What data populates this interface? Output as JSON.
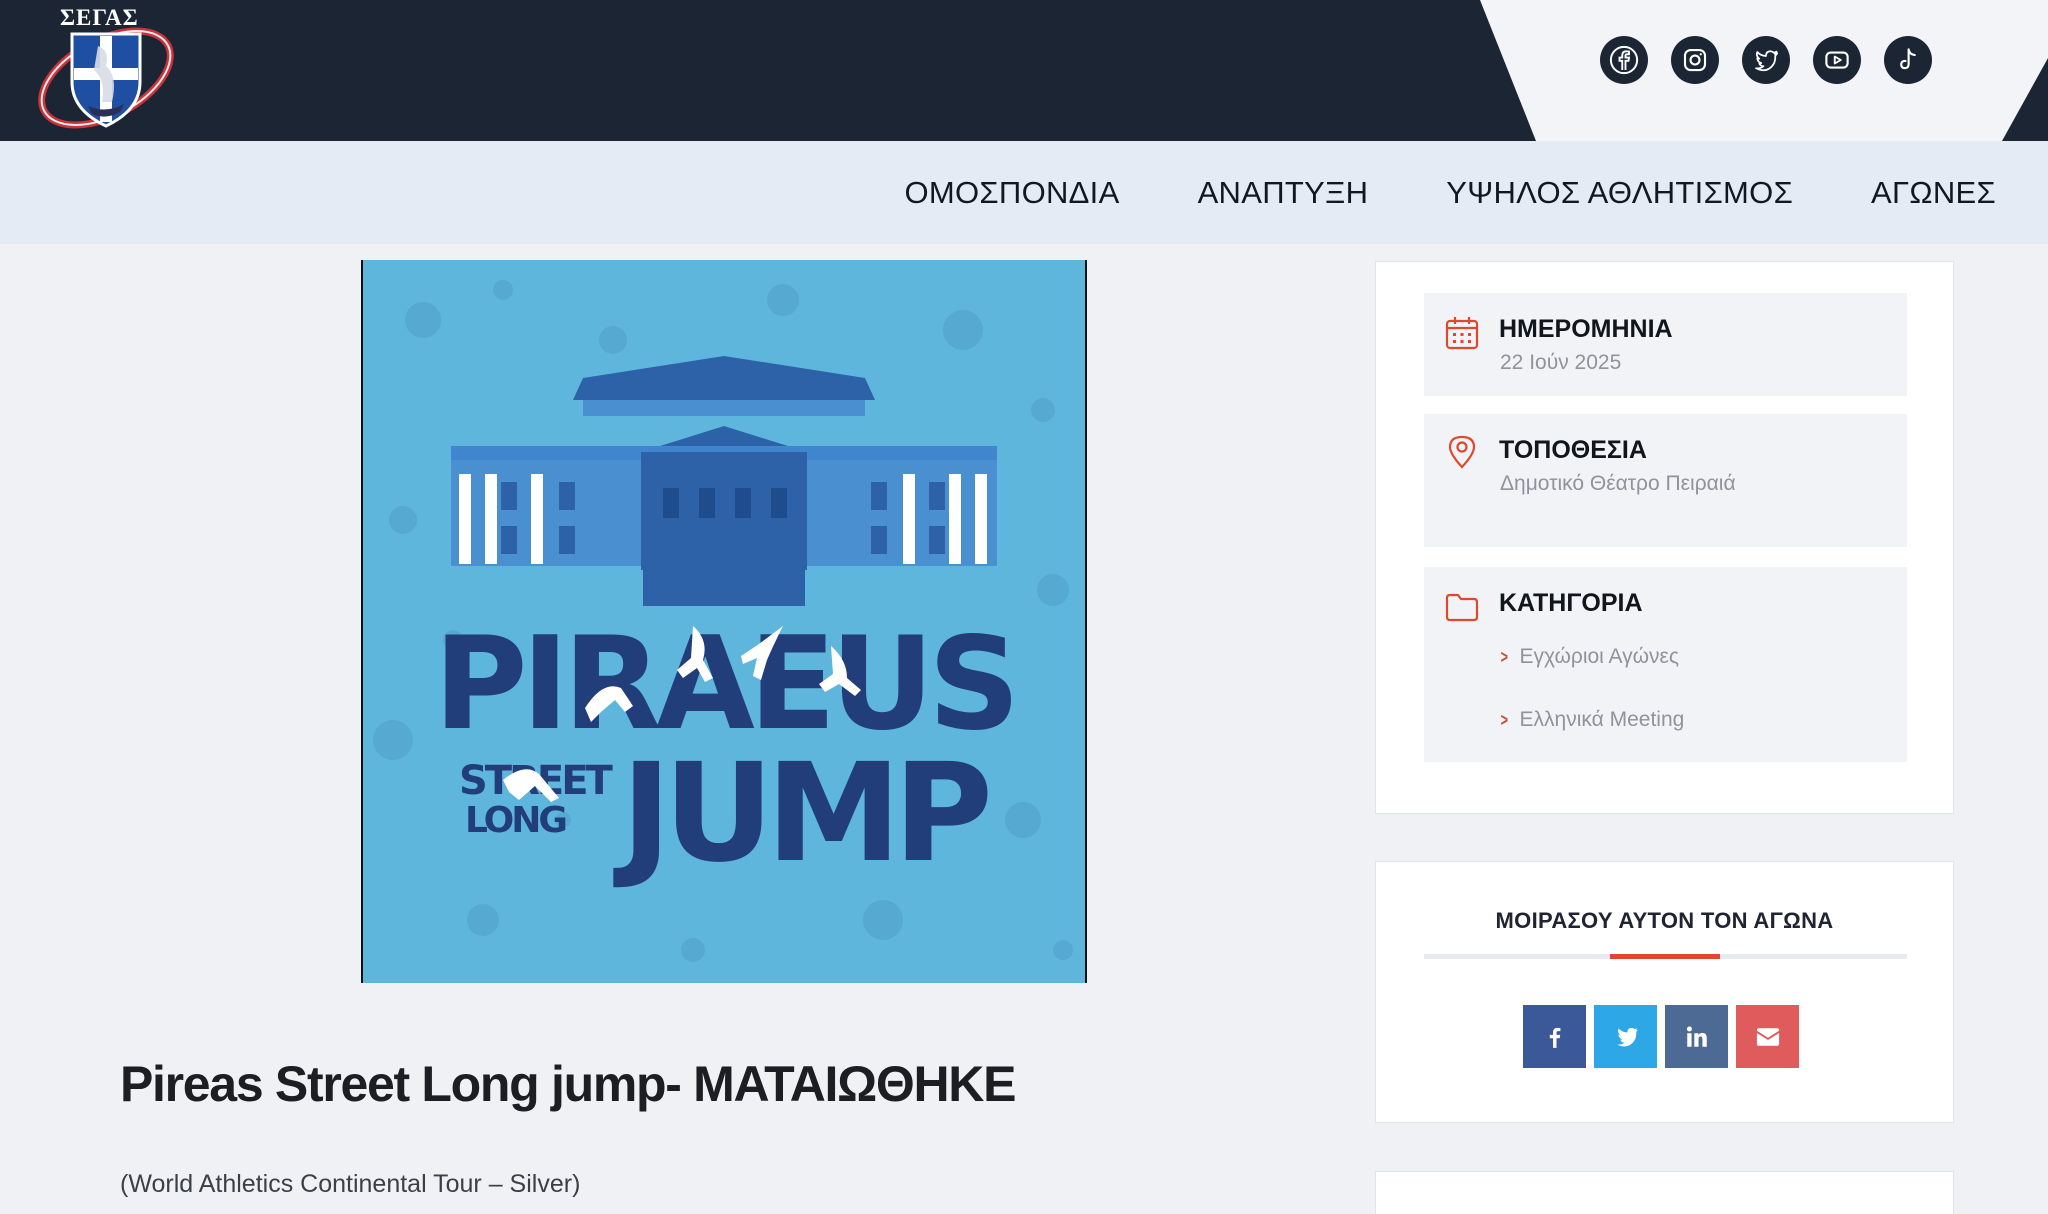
{
  "header": {
    "logo_text": "ΣΕΓΑΣ",
    "social": [
      {
        "icon": "facebook-icon"
      },
      {
        "icon": "instagram-icon"
      },
      {
        "icon": "twitter-icon"
      },
      {
        "icon": "youtube-icon"
      },
      {
        "icon": "tiktok-icon"
      }
    ]
  },
  "nav": {
    "items": [
      "ΟΜΟΣΠΟΝΔΙΑ",
      "ΑΝΑΠΤΥΞΗ",
      "ΥΨΗΛΟΣ ΑΘΛΗΤΙΣΜΟΣ",
      "ΑΓΩΝΕΣ"
    ]
  },
  "hero": {
    "word1": "PIRAEUS",
    "word2": "JUMP",
    "small1": "STREET",
    "small2": "LONG"
  },
  "event": {
    "title": "Pireas Street Long jump- ΜΑΤΑΙΩΘΗΚΕ",
    "subtitle": "(World Athletics Continental Tour – Silver)"
  },
  "sidebar": {
    "date_label": "ΗΜΕΡΟΜΗΝΙΑ",
    "date_value": "22 Ιούν 2025",
    "location_label": "ΤΟΠΟΘΕΣΙΑ",
    "location_value": "Δημοτικό Θέατρο Πειραιά",
    "category_label": "ΚΑΤΗΓΟΡΙΑ",
    "categories": [
      "Εγχώριοι Αγώνες",
      "Ελληνικά Meeting"
    ]
  },
  "share": {
    "title": "ΜΟΙΡΑΣΟΥ ΑΥΤΟΝ ΤΟΝ ΑΓΩΝΑ",
    "buttons": [
      {
        "icon": "facebook-icon",
        "color": "#3b5998"
      },
      {
        "icon": "twitter-icon",
        "color": "#2ea7e6"
      },
      {
        "icon": "linkedin-icon",
        "color": "#4c6a94"
      },
      {
        "icon": "email-icon",
        "color": "#e05c5c"
      }
    ]
  },
  "colors": {
    "header_bg": "#1b2534",
    "nav_bg": "#e5ebf4",
    "accent": "#e0472f",
    "hero_bg": "#5fb6dd",
    "hero_text": "#213d7a"
  }
}
